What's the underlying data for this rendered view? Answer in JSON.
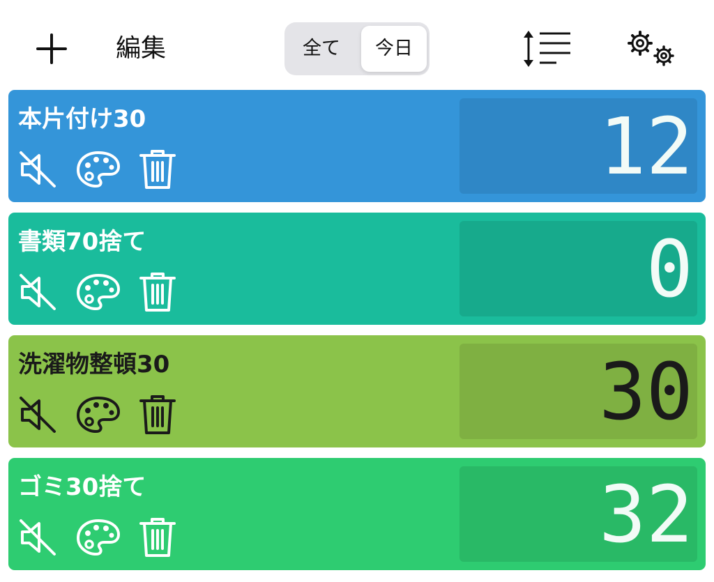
{
  "toolbar": {
    "add_icon": "plus-icon",
    "edit_label": "編集",
    "segments": [
      "全て",
      "今日"
    ],
    "selected_segment": "今日",
    "sort_icon": "sort-lines-icon",
    "settings_icon": "gears-icon"
  },
  "tasks": [
    {
      "title": "本片付け30",
      "count": "12",
      "bg": "#3495d9",
      "box": "#2f87c6",
      "fg": "#ffffff"
    },
    {
      "title": "書類70捨て",
      "count": "0",
      "bg": "#1abc9c",
      "box": "#17aa8c",
      "fg": "#ffffff"
    },
    {
      "title": "洗濯物整頓30",
      "count": "30",
      "bg": "#8bc34a",
      "box": "#7fb042",
      "fg": "#1a1a1a"
    },
    {
      "title": "ゴミ30捨て",
      "count": "32",
      "bg": "#2ecc71",
      "box": "#29b966",
      "fg": "#ffffff"
    }
  ]
}
